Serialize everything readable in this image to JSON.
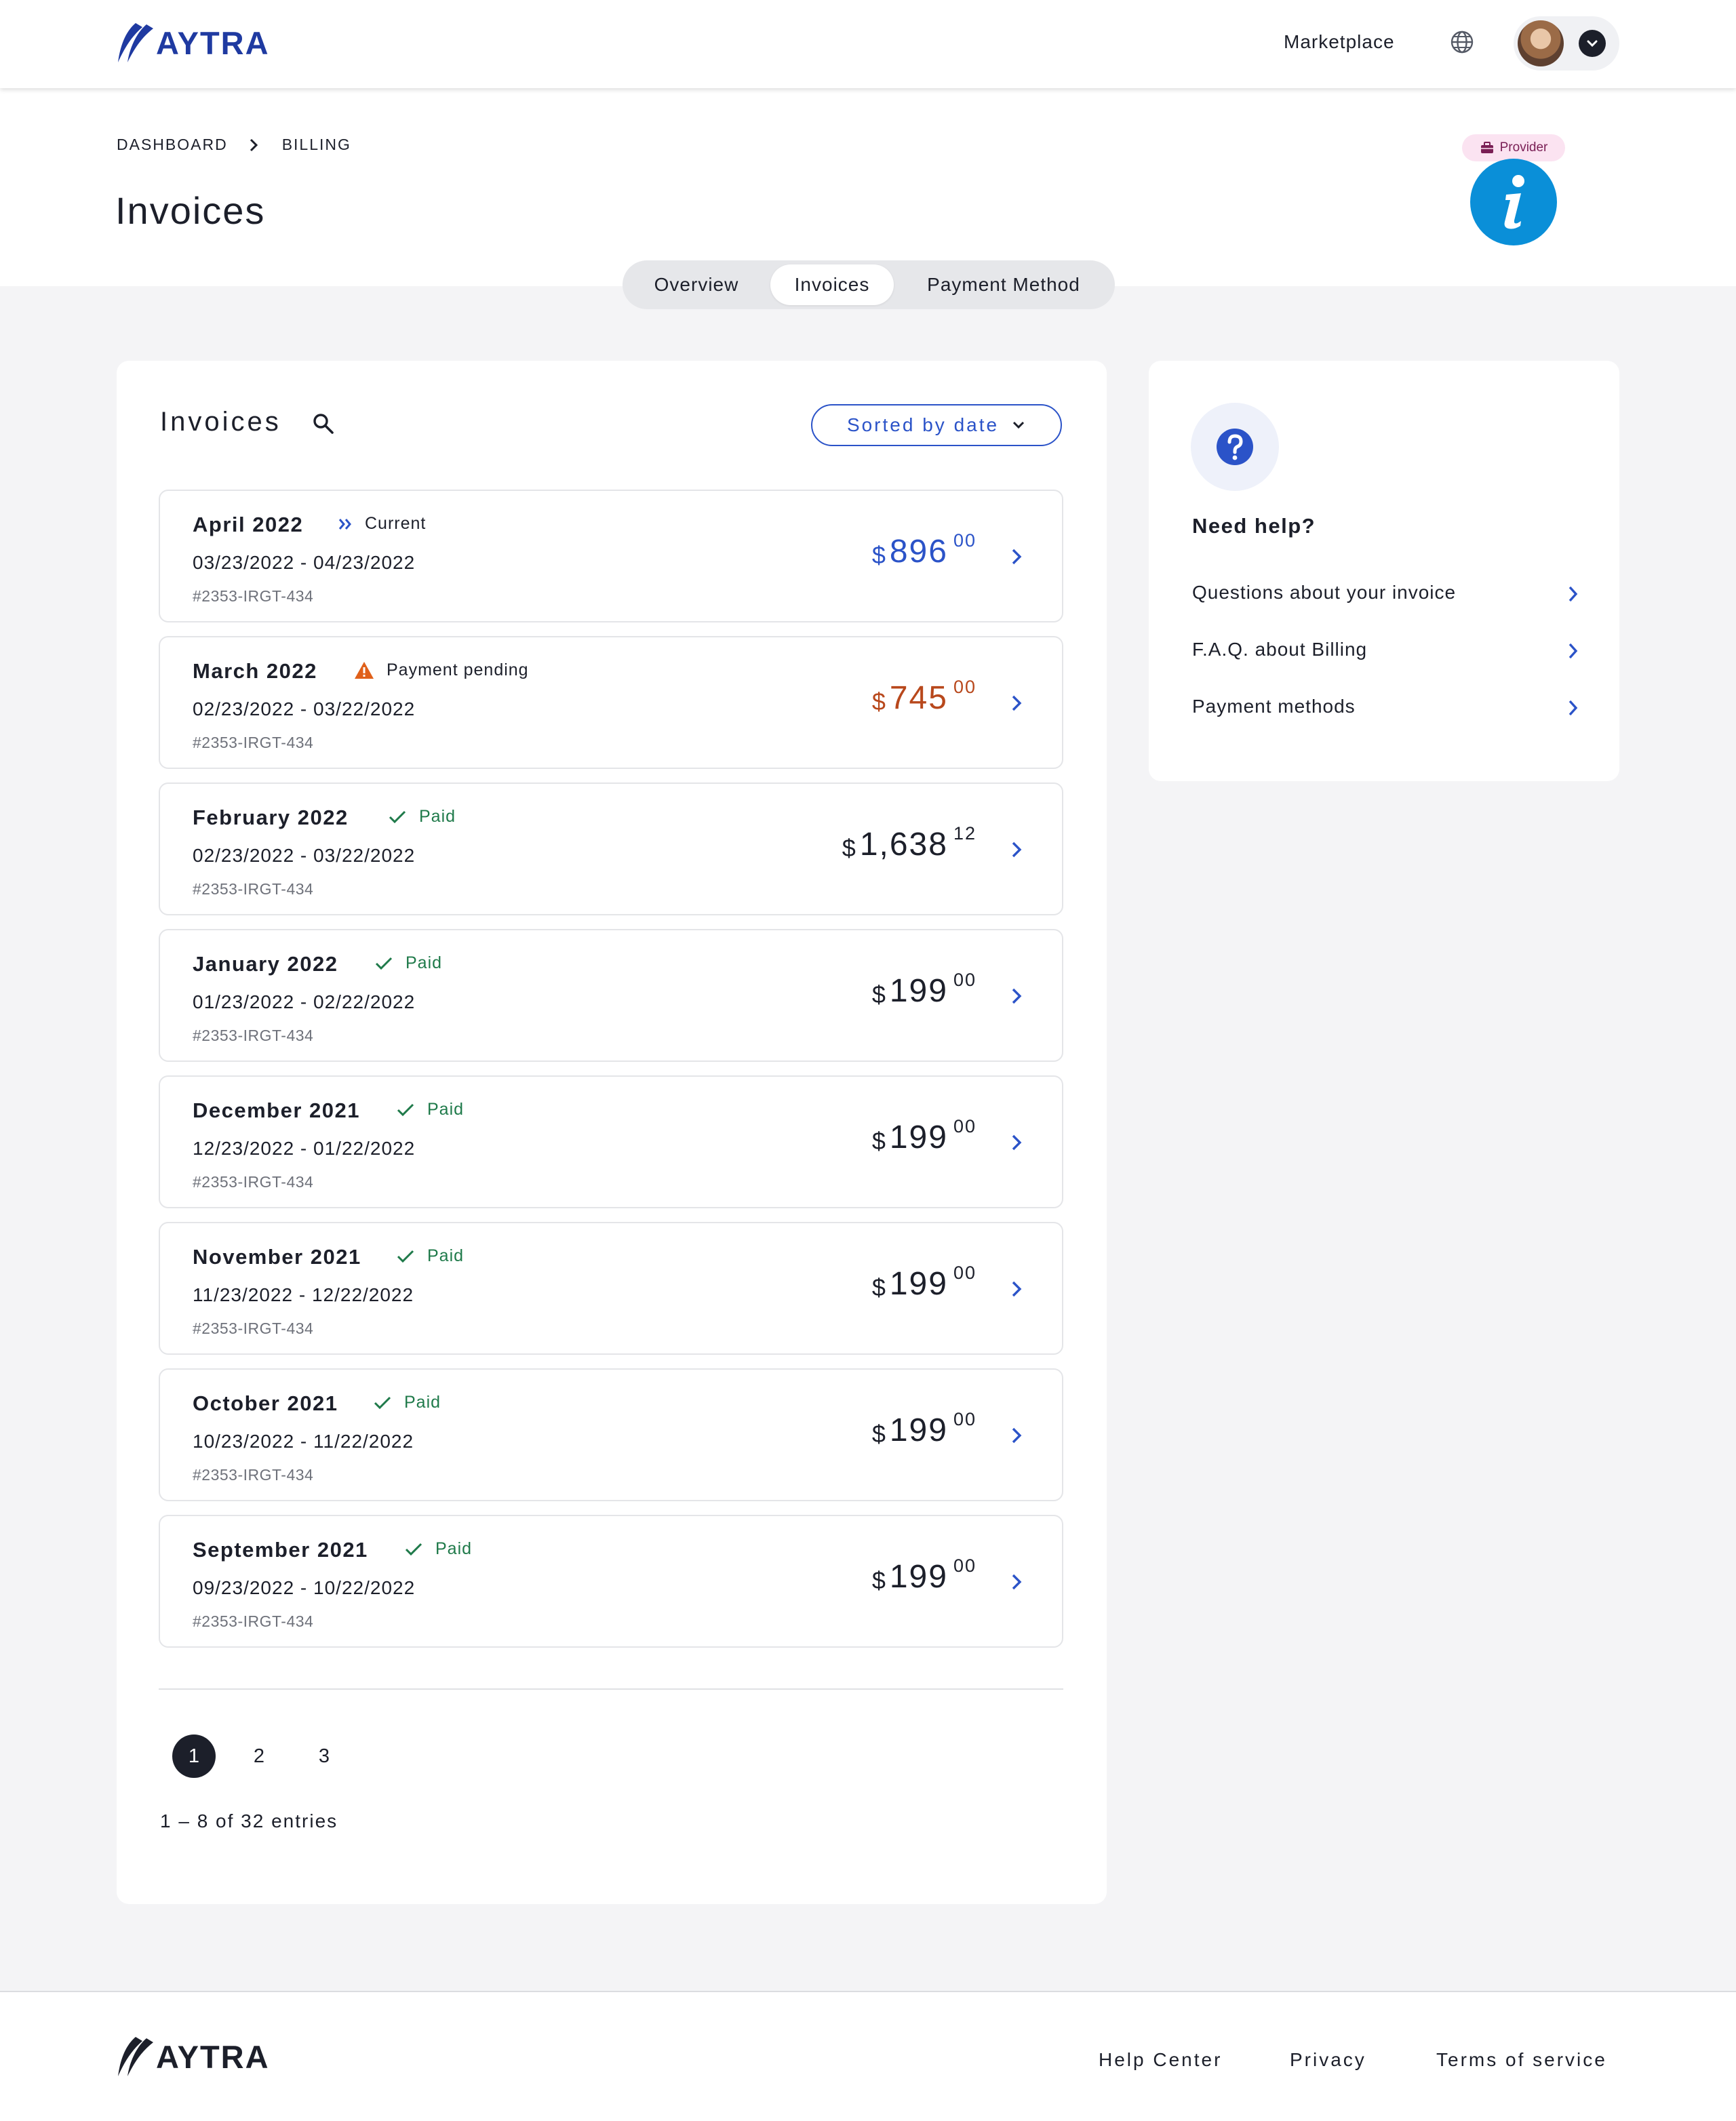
{
  "brand": {
    "name": "AYTRA",
    "color": "#1f3aa1"
  },
  "header": {
    "marketplace_label": "Marketplace",
    "globe_icon": "globe-icon",
    "avatar": "user-avatar",
    "dropdown_icon": "chevron-down-icon"
  },
  "breadcrumb": {
    "items": [
      "DASHBOARD",
      "BILLING"
    ]
  },
  "page": {
    "title": "Invoices",
    "badge": "Provider"
  },
  "tabs": [
    {
      "label": "Overview",
      "active": false
    },
    {
      "label": "Invoices",
      "active": true
    },
    {
      "label": "Payment Method",
      "active": false
    }
  ],
  "invoices_card": {
    "title": "Invoices",
    "sort_label": "Sorted by date",
    "items": [
      {
        "month": "April 2022",
        "status": "Current",
        "status_type": "current",
        "range": "03/23/2022 - 04/23/2022",
        "id": "#2353-IRGT-434",
        "currency": "$",
        "whole": "896",
        "cents": "00",
        "color": "#2b53c8"
      },
      {
        "month": "March 2022",
        "status": "Payment pending",
        "status_type": "pending",
        "range": "02/23/2022 - 03/22/2022",
        "id": "#2353-IRGT-434",
        "currency": "$",
        "whole": "745",
        "cents": "00",
        "color": "#b8481c"
      },
      {
        "month": "February 2022",
        "status": "Paid",
        "status_type": "paid",
        "range": "02/23/2022 - 03/22/2022",
        "id": "#2353-IRGT-434",
        "currency": "$",
        "whole": "1,638",
        "cents": "12",
        "color": "#1c1f2a"
      },
      {
        "month": "January 2022",
        "status": "Paid",
        "status_type": "paid",
        "range": "01/23/2022 - 02/22/2022",
        "id": "#2353-IRGT-434",
        "currency": "$",
        "whole": "199",
        "cents": "00",
        "color": "#1c1f2a"
      },
      {
        "month": "December 2021",
        "status": "Paid",
        "status_type": "paid",
        "range": "12/23/2022 - 01/22/2022",
        "id": "#2353-IRGT-434",
        "currency": "$",
        "whole": "199",
        "cents": "00",
        "color": "#1c1f2a"
      },
      {
        "month": "November 2021",
        "status": "Paid",
        "status_type": "paid",
        "range": "11/23/2022 - 12/22/2022",
        "id": "#2353-IRGT-434",
        "currency": "$",
        "whole": "199",
        "cents": "00",
        "color": "#1c1f2a"
      },
      {
        "month": "October 2021",
        "status": "Paid",
        "status_type": "paid",
        "range": "10/23/2022 - 11/22/2022",
        "id": "#2353-IRGT-434",
        "currency": "$",
        "whole": "199",
        "cents": "00",
        "color": "#1c1f2a"
      },
      {
        "month": "September 2021",
        "status": "Paid",
        "status_type": "paid",
        "range": "09/23/2022 - 10/22/2022",
        "id": "#2353-IRGT-434",
        "currency": "$",
        "whole": "199",
        "cents": "00",
        "color": "#1c1f2a"
      }
    ],
    "pages": [
      "1",
      "2",
      "3"
    ],
    "current_page": "1",
    "entries_text": "1 – 8 of 32 entries"
  },
  "help_card": {
    "title": "Need help?",
    "links": [
      "Questions about your invoice",
      "F.A.Q. about Billing",
      "Payment methods"
    ]
  },
  "footer": {
    "links": [
      "Help Center",
      "Privacy",
      "Terms of service"
    ]
  },
  "colors": {
    "accent": "#2b53c8",
    "paid": "#1f7a4a",
    "pending": "#e0601a",
    "info": "#0a8fd8"
  }
}
